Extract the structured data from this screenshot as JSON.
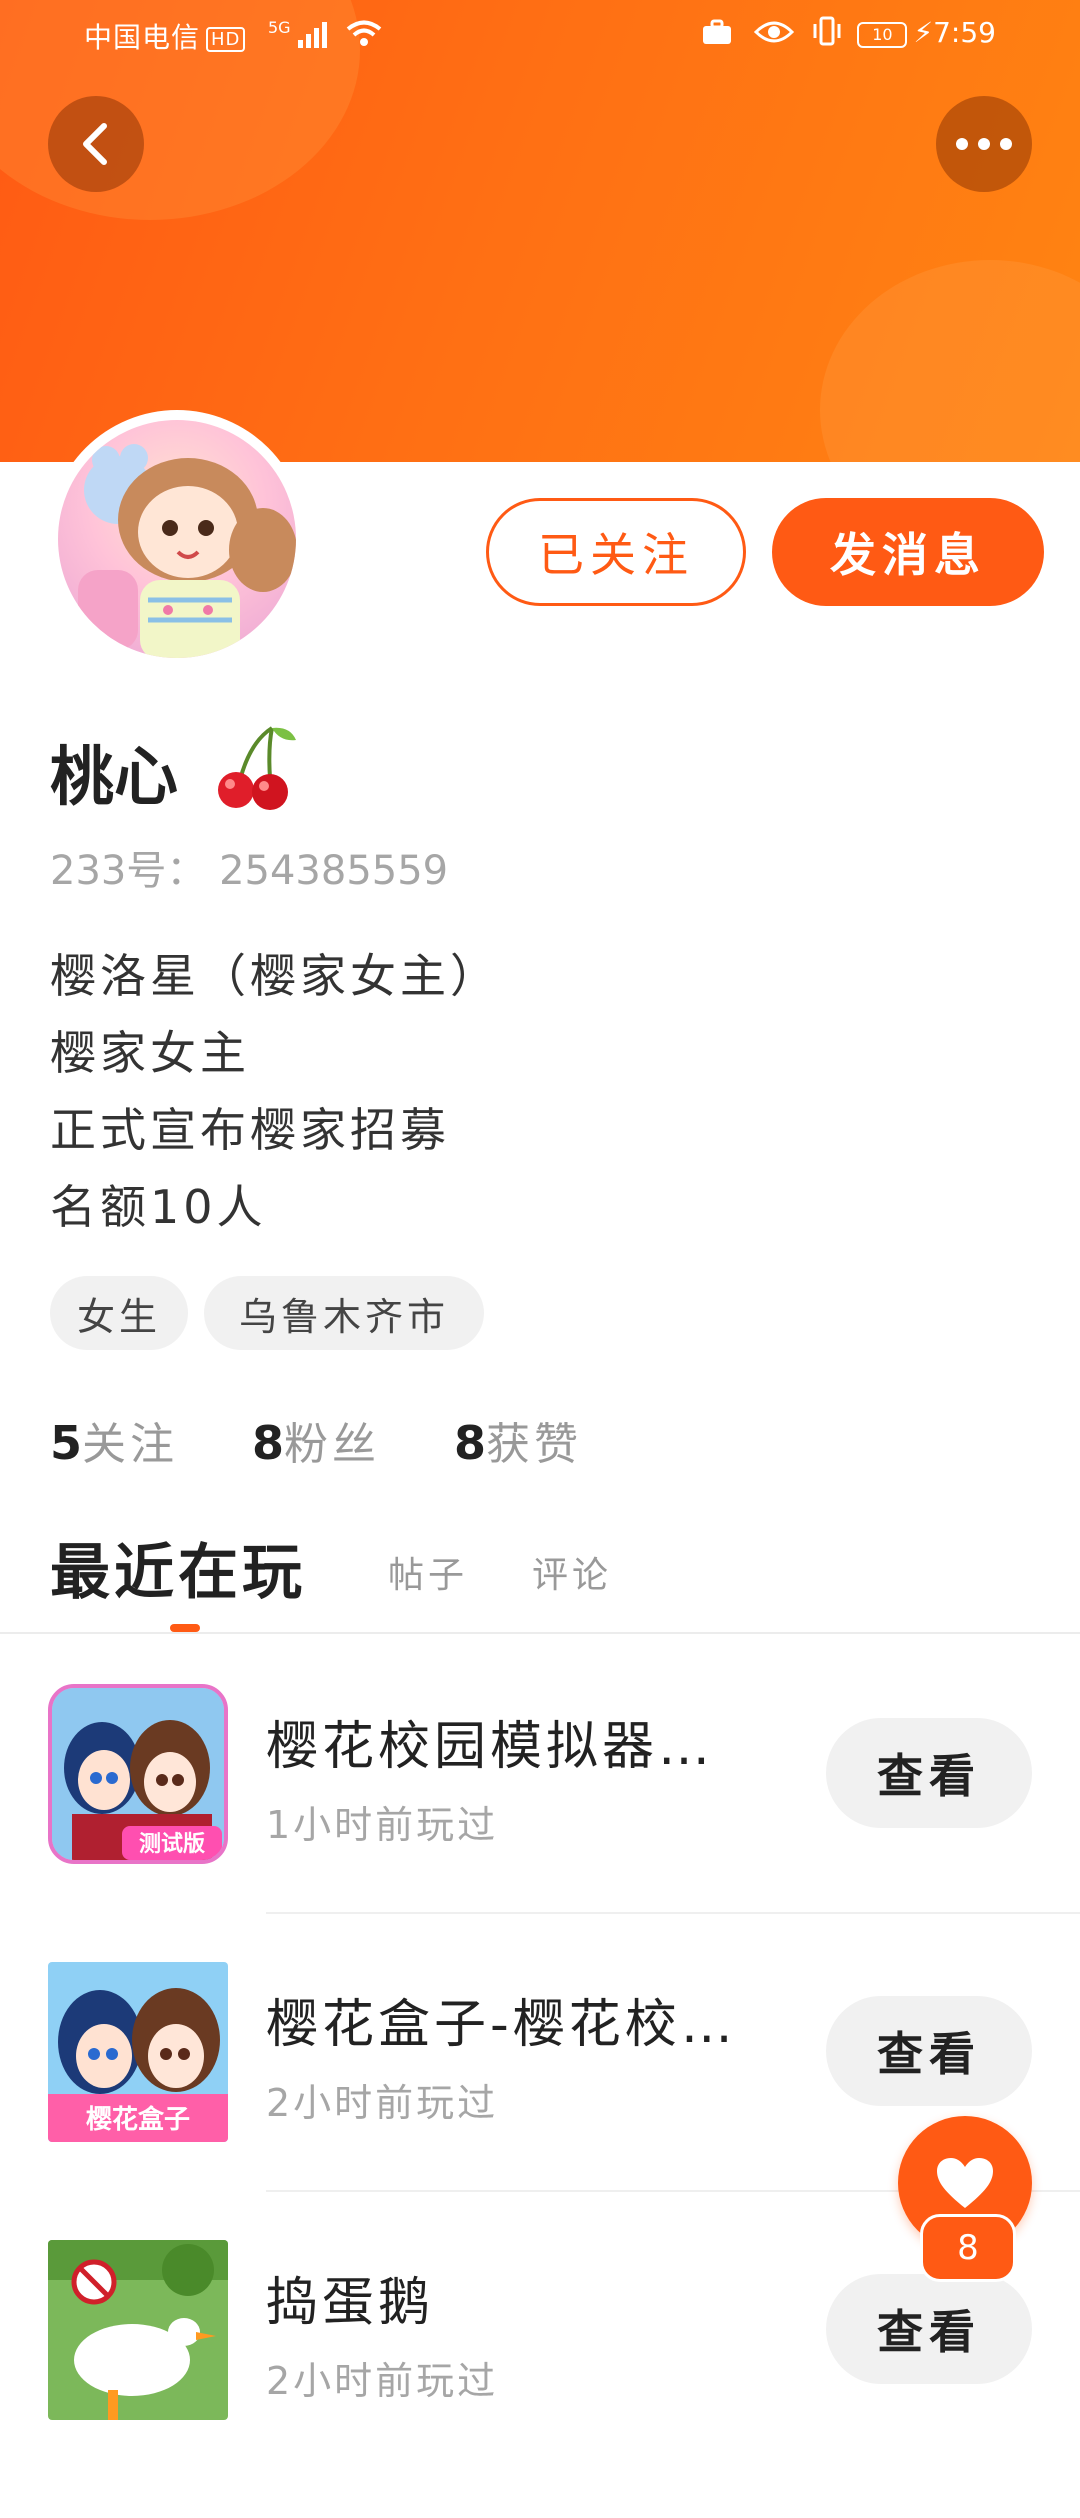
{
  "status_bar": {
    "carrier": "中国电信",
    "hd": "HD",
    "network": "5G",
    "battery": "10",
    "time": "7:59"
  },
  "header": {
    "accent_color": "#ff5a14"
  },
  "profile": {
    "follow_button": "已关注",
    "message_button": "发消息",
    "name": "桃心",
    "id_label": "233号：",
    "id_value": "254385559",
    "bio": [
      "樱洛星（樱家女主）",
      "樱家女主",
      "正式宣布樱家招募",
      "名额10人"
    ],
    "tags": [
      "女生",
      "乌鲁木齐市"
    ],
    "stats": {
      "following_count": "5",
      "following_label": "关注",
      "fans_count": "8",
      "fans_label": "粉丝",
      "likes_count": "8",
      "likes_label": "获赞"
    }
  },
  "tabs": {
    "active": "最近在玩",
    "posts": "帖子",
    "comments": "评论"
  },
  "games": [
    {
      "title": "樱花校园模拟器…",
      "time": "1小时前玩过",
      "button": "查看",
      "icon_badge": "测试版"
    },
    {
      "title": "樱花盒子-樱花校…",
      "time": "2小时前玩过",
      "button": "查看",
      "icon_badge": "樱花盒子"
    },
    {
      "title": "捣蛋鹅",
      "time": "2小时前玩过",
      "button": "查看"
    }
  ],
  "like_fab": {
    "count": "8"
  }
}
